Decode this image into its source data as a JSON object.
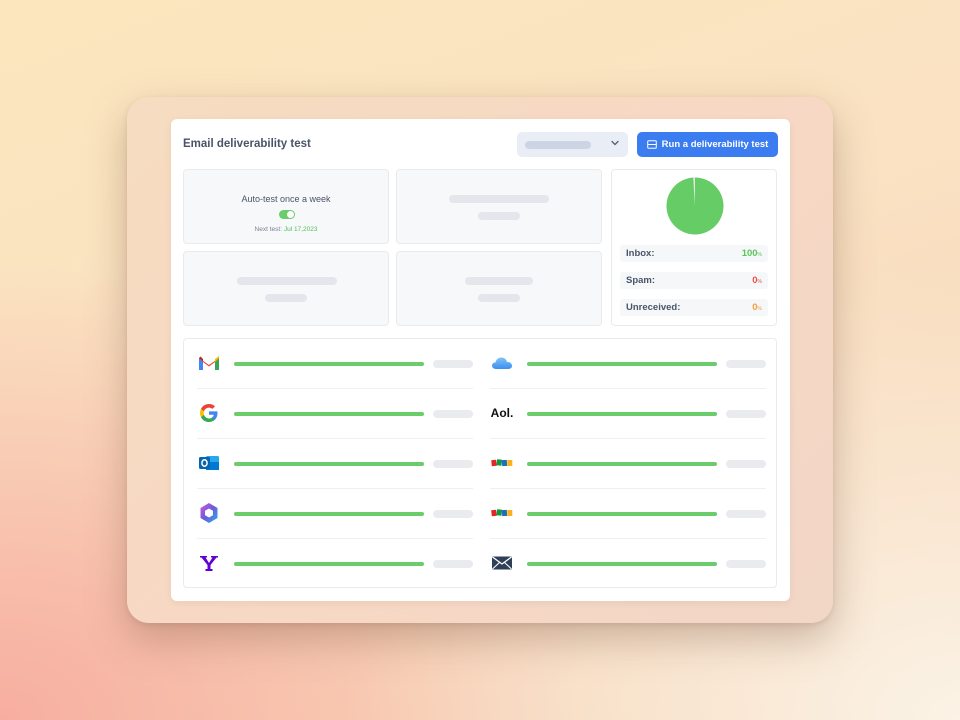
{
  "app": {
    "title": "Email deliverability test",
    "run_button_label": "Run a deliverability test"
  },
  "auto_test": {
    "label": "Auto-test once a week",
    "enabled": true,
    "next_test_prefix": "Next test:",
    "next_test_date": "Jul 17,2023"
  },
  "results": {
    "inbox": {
      "label": "Inbox:",
      "value": "100",
      "unit": "%",
      "color": "#5cc45c"
    },
    "spam": {
      "label": "Spam:",
      "value": "0",
      "unit": "%",
      "color": "#e5534b"
    },
    "unreceived": {
      "label": "Unreceived:",
      "value": "0",
      "unit": "%",
      "color": "#f0a040"
    }
  },
  "pie_chart": {
    "inbox_fraction": 0.99,
    "color_inbox": "#66cc66",
    "color_other": "#e6e6e6"
  },
  "providers": {
    "left": [
      {
        "icon": "gmail-icon",
        "progress": 1.0
      },
      {
        "icon": "google-icon",
        "progress": 1.0
      },
      {
        "icon": "outlook-icon",
        "progress": 1.0
      },
      {
        "icon": "microsoft365-icon",
        "progress": 1.0
      },
      {
        "icon": "yahoo-icon",
        "progress": 1.0
      }
    ],
    "right": [
      {
        "icon": "icloud-icon",
        "progress": 1.0
      },
      {
        "icon": "aol-icon",
        "label": "Aol.",
        "progress": 1.0
      },
      {
        "icon": "zoho-icon",
        "progress": 1.0
      },
      {
        "icon": "zoho-icon",
        "progress": 1.0
      },
      {
        "icon": "envelope-icon",
        "progress": 1.0
      }
    ]
  },
  "colors": {
    "accent": "#3b7cf0",
    "success": "#6acc6a"
  }
}
